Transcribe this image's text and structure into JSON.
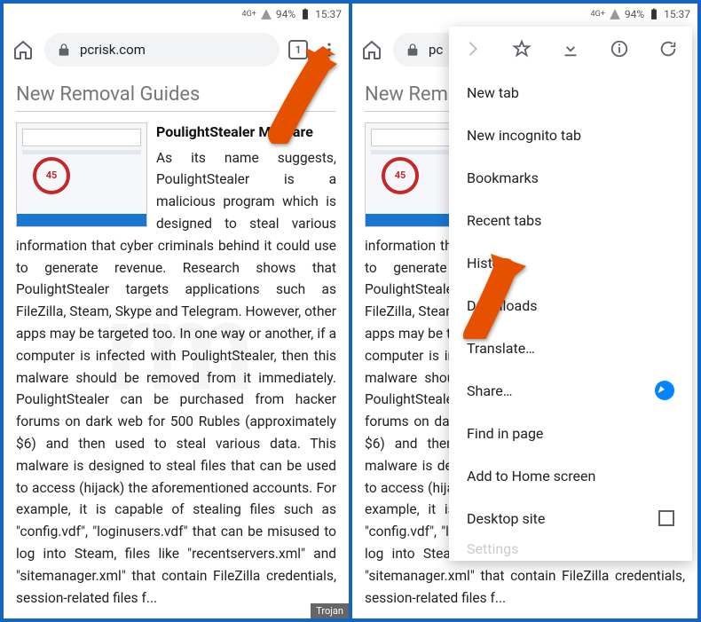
{
  "status": {
    "network": "4G+",
    "battery_pct": "94%",
    "time": "15:37"
  },
  "toolbar": {
    "url": "pcrisk.com",
    "tab_count": "1"
  },
  "page": {
    "section_title": "New Removal Guides",
    "article_title": "PoulightStealer Malware",
    "thumb_value": "45",
    "tag": "Trojan",
    "body": "As its name suggests, PoulightStealer is a malicious program which is designed to steal various information that cyber criminals behind it could use to generate revenue. Research shows that PoulightStealer targets applications such as FileZilla, Steam, Skype and Telegram. However, other apps may be targeted too. In one way or another, if a computer is infected with PoulightStealer, then this malware should be removed from it immediately. PoulightStealer can be purchased from hacker forums on dark web for 500 Rubles (approximately $6) and then used to steal various data. This malware is designed to steal files that can be used to access (hijack) the aforementioned accounts. For example, it is capable of stealing files such as \"config.vdf\", \"loginusers.vdf\" that can be misused to log into Steam, files like \"recentservers.xml\" and \"sitemanager.xml\" that contain FileZilla credentials, session-related files f..."
  },
  "menu": {
    "items": [
      "New tab",
      "New incognito tab",
      "Bookmarks",
      "Recent tabs",
      "History",
      "Downloads",
      "Translate…",
      "Share…",
      "Find in page",
      "Add to Home screen",
      "Desktop site"
    ],
    "settings": "Settings"
  },
  "toolbar2_url": "pc",
  "wm": "rm"
}
